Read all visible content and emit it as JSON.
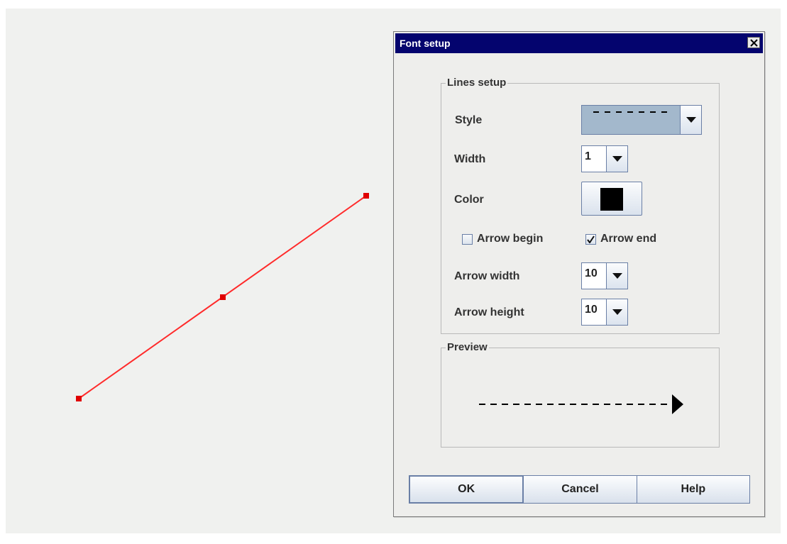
{
  "dialog": {
    "title": "Font setup",
    "lines_group_title": "Lines setup",
    "style_label": "Style",
    "width_label": "Width",
    "width_value": "1",
    "color_label": "Color",
    "color_value": "#000000",
    "arrow_begin_label": "Arrow begin",
    "arrow_begin_checked": false,
    "arrow_end_label": "Arrow end",
    "arrow_end_checked": true,
    "arrow_width_label": "Arrow width",
    "arrow_width_value": "10",
    "arrow_height_label": "Arrow height",
    "arrow_height_value": "10",
    "preview_group_title": "Preview",
    "ok_label": "OK",
    "cancel_label": "Cancel",
    "help_label": "Help"
  },
  "canvas": {
    "line_color": "#ff0000",
    "handle_color": "#ff0000"
  }
}
